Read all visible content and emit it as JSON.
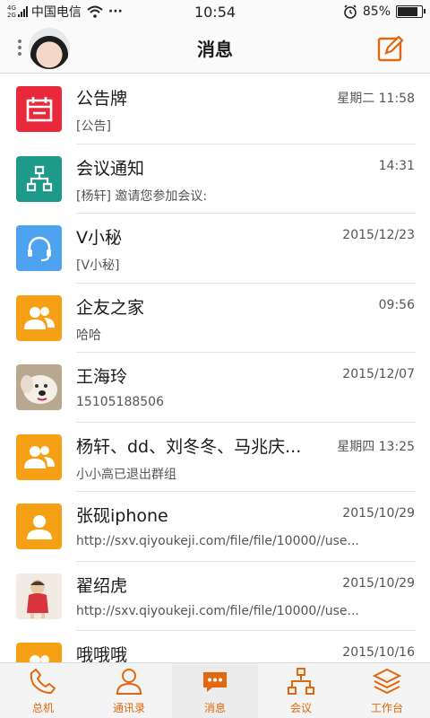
{
  "status_bar": {
    "network_top": "4G",
    "network_bottom": "2G",
    "carrier": "中国电信",
    "wifi_icon": "wifi-icon",
    "more": "···",
    "time": "10:54",
    "alarm_icon": "alarm-icon",
    "battery": "85%",
    "battery_level": 0.85
  },
  "header": {
    "title": "消息",
    "menu_icon": "more-vertical-icon",
    "avatar": "avatar",
    "compose_icon": "compose-icon"
  },
  "colors": {
    "accent": "#e2670f",
    "red": "#e8293b",
    "teal": "#1d9a8a",
    "blue": "#4da3f0",
    "orange": "#f5a015"
  },
  "conversations": [
    {
      "name": "公告牌",
      "time": "星期二 11:58",
      "preview": "[公告]",
      "icon": "calendar-icon",
      "color": "#e8293b"
    },
    {
      "name": "会议通知",
      "time": "14:31",
      "preview": "[杨轩] 邀请您参加会议:",
      "icon": "org-chart-icon",
      "color": "#1d9a8a"
    },
    {
      "name": "V小秘",
      "time": "2015/12/23",
      "preview": "[V小秘]",
      "icon": "headset-icon",
      "color": "#4da3f0"
    },
    {
      "name": "企友之家",
      "time": "09:56",
      "preview": "哈哈",
      "icon": "group-icon",
      "color": "#f5a015"
    },
    {
      "name": "王海玲",
      "time": "2015/12/07",
      "preview": "15105188506",
      "icon": "dog-photo",
      "color": "#c9b79d"
    },
    {
      "name": "杨轩、dd、刘冬冬、马兆庆...",
      "time": "星期四 13:25",
      "preview": "小小高已退出群组",
      "icon": "group-icon",
      "color": "#f5a015"
    },
    {
      "name": "张砚iphone",
      "time": "2015/10/29",
      "preview": "http://sxv.qiyoukeji.com/file/file/10000//use...",
      "icon": "person-icon",
      "color": "#f5a015"
    },
    {
      "name": "翟绍虎",
      "time": "2015/10/29",
      "preview": "http://sxv.qiyoukeji.com/file/file/10000//use...",
      "icon": "child-photo",
      "color": "#e9dbd0"
    },
    {
      "name": "哦哦哦",
      "time": "2015/10/16",
      "preview": "",
      "icon": "group-icon",
      "color": "#f5a015"
    }
  ],
  "tabs": [
    {
      "label": "总机",
      "icon": "phone-icon",
      "active": false
    },
    {
      "label": "通讯录",
      "icon": "contacts-icon",
      "active": false
    },
    {
      "label": "消息",
      "icon": "chat-icon",
      "active": true
    },
    {
      "label": "会议",
      "icon": "meeting-icon",
      "active": false
    },
    {
      "label": "工作台",
      "icon": "layers-icon",
      "active": false
    }
  ]
}
